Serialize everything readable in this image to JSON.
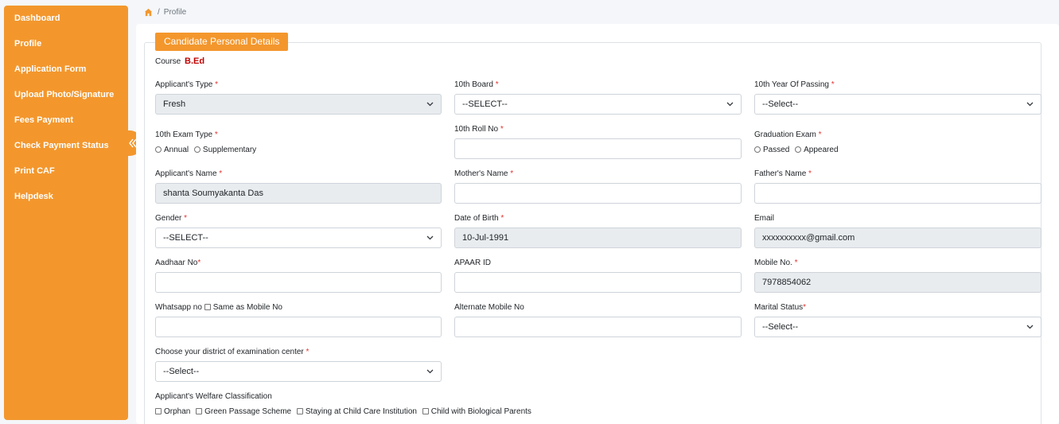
{
  "sidebar": {
    "items": [
      {
        "label": "Dashboard"
      },
      {
        "label": "Profile"
      },
      {
        "label": "Application Form"
      },
      {
        "label": "Upload Photo/Signature"
      },
      {
        "label": "Fees Payment"
      },
      {
        "label": "Check Payment Status"
      },
      {
        "label": "Print CAF"
      },
      {
        "label": "Helpdesk"
      }
    ]
  },
  "breadcrumb": {
    "sep": "/",
    "current": "Profile"
  },
  "section": {
    "title": "Candidate Personal Details"
  },
  "course": {
    "label": "Course",
    "value": "B.Ed"
  },
  "required_mark": "*",
  "fields": {
    "applicant_type": {
      "label": "Applicant's Type",
      "value": "Fresh"
    },
    "board_10th": {
      "label": "10th Board",
      "value": "--SELECT--"
    },
    "year_10th": {
      "label": "10th Year Of Passing",
      "value": "--Select--"
    },
    "exam_type_10th": {
      "label": "10th Exam Type",
      "options": [
        "Annual",
        "Supplementary"
      ]
    },
    "roll_10th": {
      "label": "10th Roll No",
      "value": ""
    },
    "graduation_exam": {
      "label": "Graduation Exam",
      "options": [
        "Passed",
        "Appeared"
      ]
    },
    "applicant_name": {
      "label": "Applicant's Name",
      "value": "shanta Soumyakanta Das"
    },
    "mother_name": {
      "label": "Mother's Name",
      "value": ""
    },
    "father_name": {
      "label": "Father's Name",
      "value": ""
    },
    "gender": {
      "label": "Gender",
      "value": "--SELECT--"
    },
    "dob": {
      "label": "Date of Birth",
      "value": "10-Jul-1991"
    },
    "email": {
      "label": "Email",
      "value": "xxxxxxxxxx@gmail.com"
    },
    "aadhaar": {
      "label": "Aadhaar No",
      "value": ""
    },
    "apaar": {
      "label": "APAAR ID",
      "value": ""
    },
    "mobile": {
      "label": "Mobile No.",
      "value": "7978854062"
    },
    "whatsapp": {
      "label": "Whatsapp no",
      "same_label": "Same as Mobile No",
      "value": ""
    },
    "alt_mobile": {
      "label": "Alternate Mobile No",
      "value": ""
    },
    "marital": {
      "label": "Marital Status",
      "value": "--Select--"
    },
    "district": {
      "label": "Choose your district of examination center",
      "value": "--Select--"
    },
    "welfare": {
      "label": "Applicant's Welfare Classification",
      "options": [
        "Orphan",
        "Green Passage Scheme",
        "Staying at Child Care Institution",
        "Child with Biological Parents"
      ]
    }
  },
  "colors": {
    "accent": "#f3972d",
    "required": "#e3342f",
    "course": "#c00000"
  }
}
